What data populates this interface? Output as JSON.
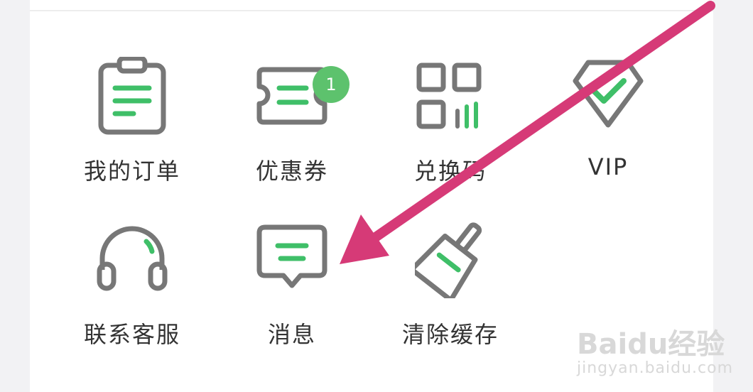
{
  "colors": {
    "icon_gray": "#777777",
    "accent_green": "#3fbf68",
    "badge_green": "#5dc26d",
    "arrow_pink": "#d63a77"
  },
  "menu": {
    "items": [
      {
        "label": "我的订单",
        "icon": "clipboard-icon"
      },
      {
        "label": "优惠券",
        "icon": "coupon-icon",
        "badge": "1"
      },
      {
        "label": "兑换码",
        "icon": "qr-code-icon"
      },
      {
        "label": "VIP",
        "icon": "vip-diamond-icon"
      },
      {
        "label": "联系客服",
        "icon": "headphones-icon"
      },
      {
        "label": "消息",
        "icon": "message-icon"
      },
      {
        "label": "清除缓存",
        "icon": "brush-icon"
      }
    ]
  },
  "watermark": {
    "logo": "Baidu经验",
    "url": "jingyan.baidu.com"
  }
}
